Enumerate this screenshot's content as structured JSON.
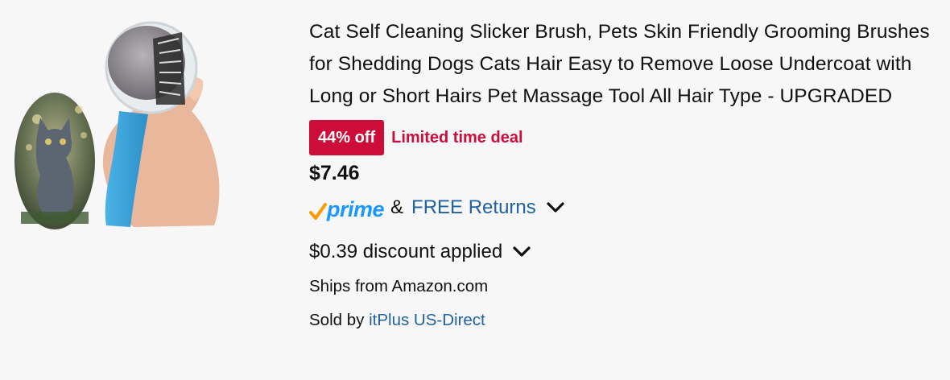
{
  "product": {
    "title": "Cat Self Cleaning Slicker Brush, Pets Skin Friendly Grooming Brushes for Shedding Dogs Cats Hair Easy to Remove Loose Undercoat with Long or Short Hairs Pet Massage Tool All Hair Type - UPGRADED",
    "image_icon": "product-image",
    "deal": {
      "badge": "44% off",
      "label": "Limited time deal",
      "color": "#cc0c39"
    },
    "price": "$7.46",
    "prime": {
      "logo": "prime",
      "connector": "&",
      "returns": "FREE Returns",
      "returns_color": "#2162a1",
      "logo_color": "#1a98ff",
      "check_color": "#ff9900"
    },
    "discount": "$0.39 discount applied",
    "ships_from": "Ships from Amazon.com",
    "sold_by_label": "Sold by",
    "seller": "itPlus US-Direct"
  }
}
